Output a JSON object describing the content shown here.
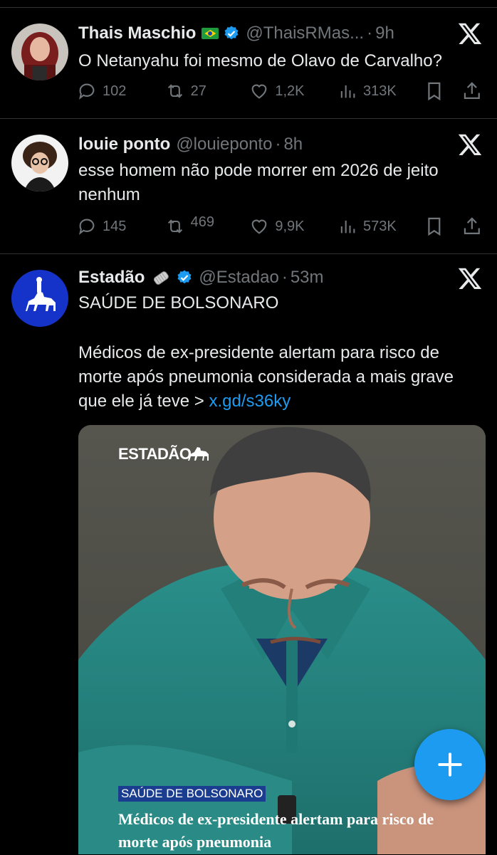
{
  "tweets": [
    {
      "name": "Thais Maschio",
      "handle": "@ThaisRMas...",
      "time": "9h",
      "text": "O Netanyahu foi mesmo de Olavo de Carvalho?",
      "replies": "102",
      "retweets": "27",
      "likes": "1,2K",
      "views": "313K"
    },
    {
      "name": "louie ponto",
      "handle": "@louieponto",
      "time": "8h",
      "text": "esse homem não pode morrer em 2026 de jeito nenhum",
      "replies": "145",
      "retweets": "469",
      "likes": "9,9K",
      "views": "573K"
    },
    {
      "name": "Estadão",
      "handle": "@Estadao",
      "time": "53m",
      "text_line1": "SAÚDE DE BOLSONARO",
      "text_body": "Médicos de ex-presidente alertam para risco de morte após pneumonia considerada a mais grave que ele já teve >",
      "link": "x.gd/s36ky",
      "media": {
        "brand": "ESTADÃO",
        "badge": "SAÚDE DE BOLSONARO",
        "headline": "Médicos de ex-presidente alertam para risco de morte após pneumonia"
      }
    }
  ],
  "separator": "·",
  "colors": {
    "background": "#000000",
    "accent": "#1d9bf0",
    "muted": "#71767b",
    "divider": "#2f3336"
  },
  "icons": [
    "reply-icon",
    "retweet-icon",
    "like-icon",
    "views-icon",
    "bookmark-icon",
    "share-icon",
    "x-logo-icon",
    "verified-badge-icon",
    "compose-plus-icon"
  ]
}
